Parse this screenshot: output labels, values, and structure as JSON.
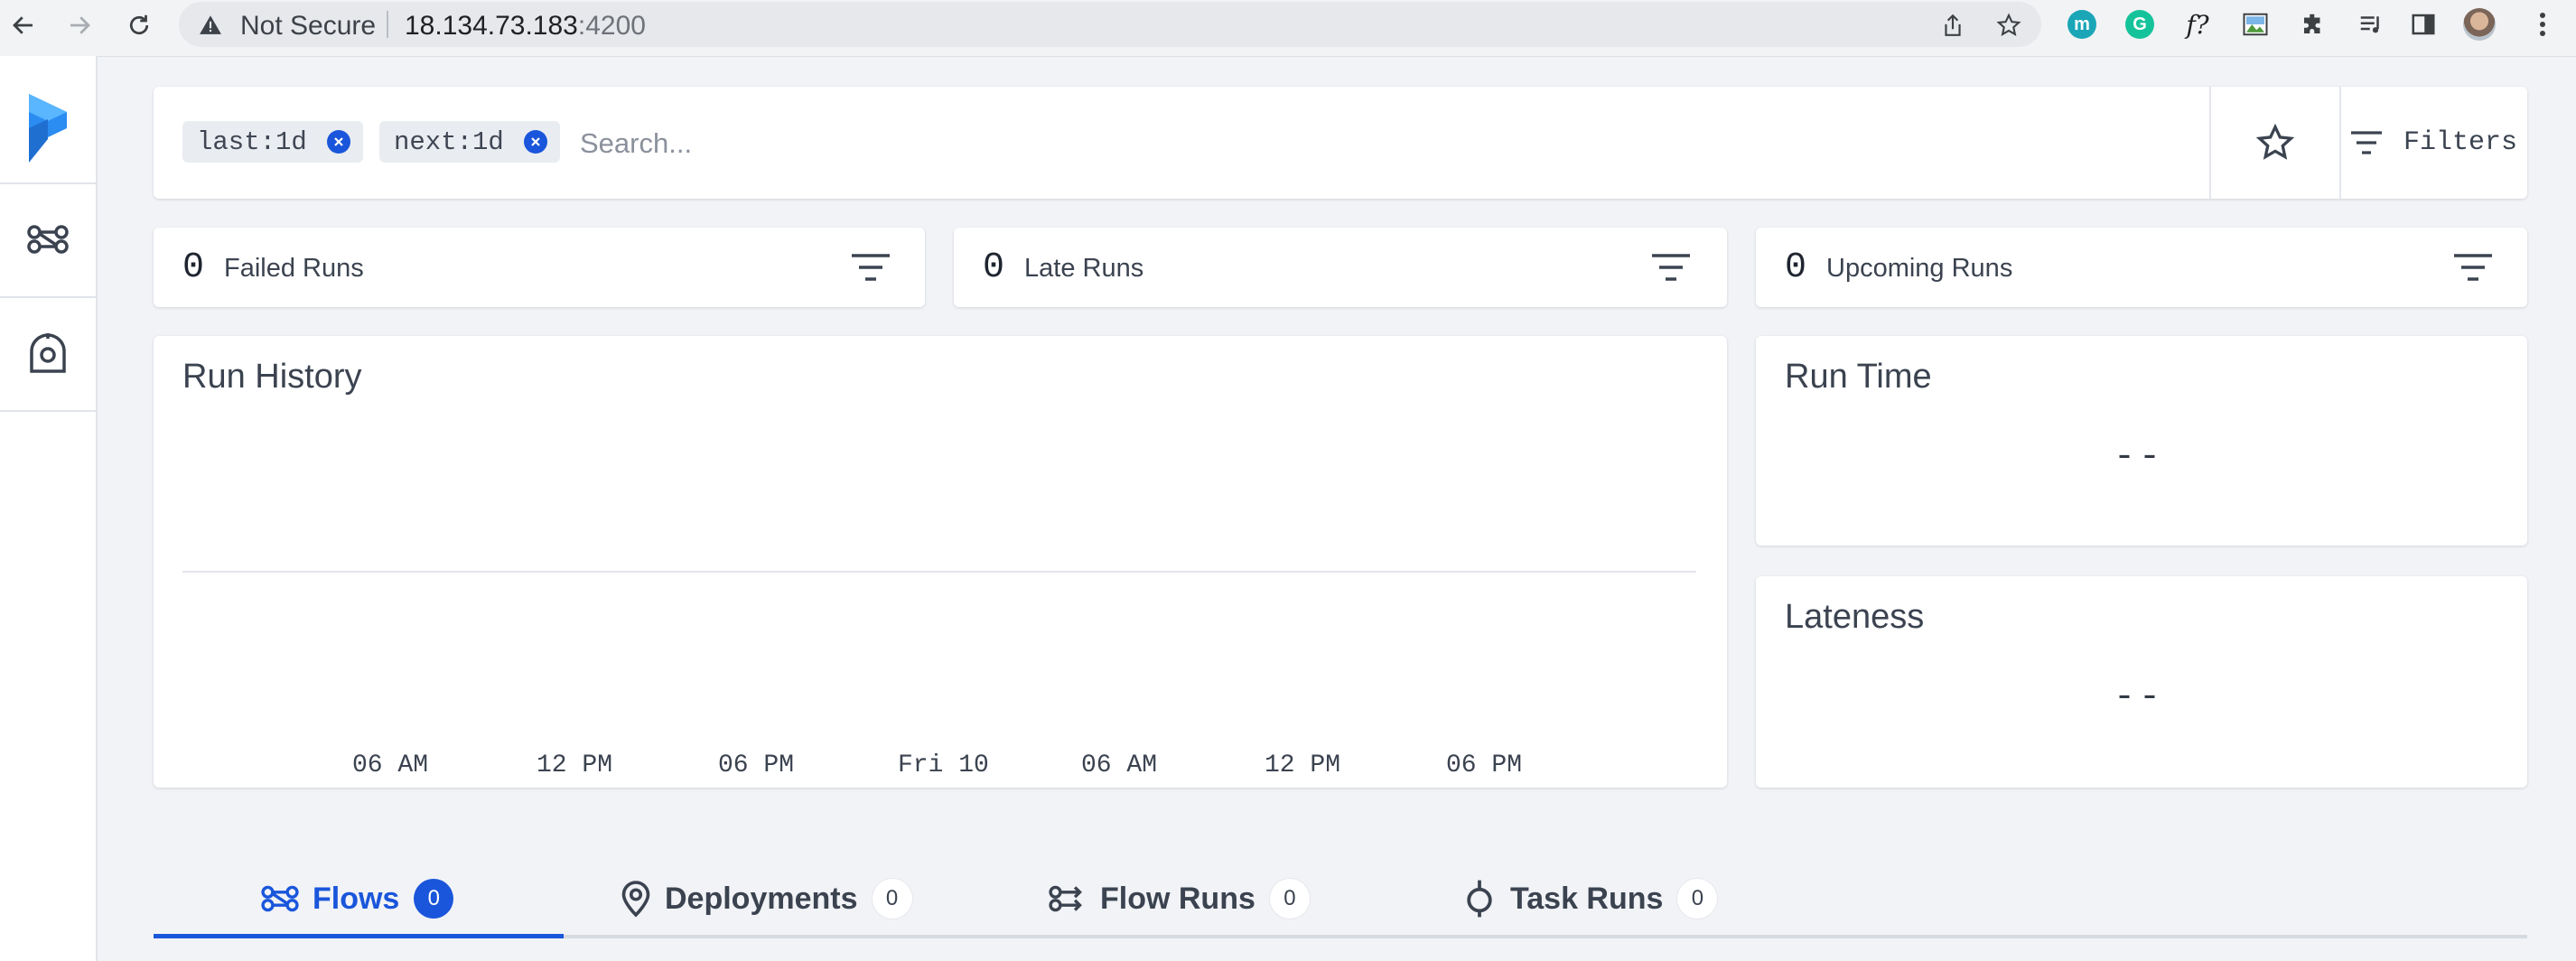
{
  "browser": {
    "security_label": "Not Secure",
    "url_host": "18.134.73.183",
    "url_port": ":4200",
    "extensions": [
      {
        "name": "m",
        "color": "#1aa6b7"
      },
      {
        "name": "G",
        "color": "#15c39a"
      },
      {
        "name": "f?",
        "color": ""
      }
    ]
  },
  "search": {
    "tags": [
      "last:1d",
      "next:1d"
    ],
    "placeholder": "Search...",
    "filters_label": "Filters"
  },
  "stats": {
    "failed": {
      "count": "0",
      "label": "Failed Runs"
    },
    "late": {
      "count": "0",
      "label": "Late Runs"
    },
    "upcoming": {
      "count": "0",
      "label": "Upcoming Runs"
    }
  },
  "run_history": {
    "title": "Run History",
    "x_ticks": [
      "06 AM",
      "12 PM",
      "06 PM",
      "Fri 10",
      "06 AM",
      "12 PM",
      "06 PM"
    ]
  },
  "run_time": {
    "title": "Run Time",
    "value": "--"
  },
  "lateness": {
    "title": "Lateness",
    "value": "--"
  },
  "tabs": [
    {
      "label": "Flows",
      "count": "0",
      "active": true
    },
    {
      "label": "Deployments",
      "count": "0",
      "active": false
    },
    {
      "label": "Flow Runs",
      "count": "0",
      "active": false
    },
    {
      "label": "Task Runs",
      "count": "0",
      "active": false
    }
  ],
  "colors": {
    "accent": "#1a56db",
    "background": "#f1f3f6"
  }
}
